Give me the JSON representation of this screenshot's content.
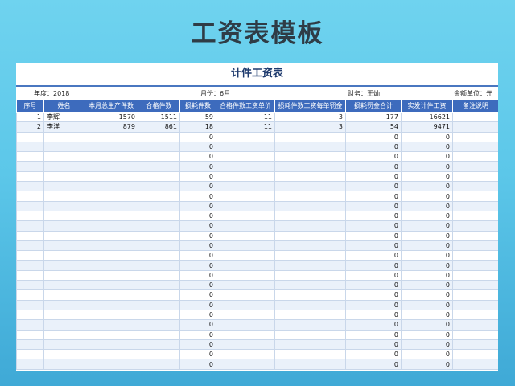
{
  "page_title": "工资表模板",
  "sheet": {
    "title": "计件工资表",
    "year_label": "年度：2018",
    "month_label": "月份：6月",
    "finance_label": "财务：王灿",
    "unit_label": "金额单位：元"
  },
  "table": {
    "headers": [
      "序号",
      "姓名",
      "本月总生产件数",
      "合格件数",
      "损耗件数",
      "合格件数工资单价",
      "损耗件数工资每单罚金",
      "损耗罚金合计",
      "实发计件工资",
      "备注说明"
    ],
    "rows": [
      [
        "1",
        "李辉",
        "1570",
        "1511",
        "59",
        "11",
        "3",
        "177",
        "16621",
        ""
      ],
      [
        "2",
        "李洋",
        "879",
        "861",
        "18",
        "11",
        "3",
        "54",
        "9471",
        ""
      ],
      [
        "",
        "",
        "",
        "",
        "0",
        "",
        "",
        "0",
        "0",
        ""
      ],
      [
        "",
        "",
        "",
        "",
        "0",
        "",
        "",
        "0",
        "0",
        ""
      ],
      [
        "",
        "",
        "",
        "",
        "0",
        "",
        "",
        "0",
        "0",
        ""
      ],
      [
        "",
        "",
        "",
        "",
        "0",
        "",
        "",
        "0",
        "0",
        ""
      ],
      [
        "",
        "",
        "",
        "",
        "0",
        "",
        "",
        "0",
        "0",
        ""
      ],
      [
        "",
        "",
        "",
        "",
        "0",
        "",
        "",
        "0",
        "0",
        ""
      ],
      [
        "",
        "",
        "",
        "",
        "0",
        "",
        "",
        "0",
        "0",
        ""
      ],
      [
        "",
        "",
        "",
        "",
        "0",
        "",
        "",
        "0",
        "0",
        ""
      ],
      [
        "",
        "",
        "",
        "",
        "0",
        "",
        "",
        "0",
        "0",
        ""
      ],
      [
        "",
        "",
        "",
        "",
        "0",
        "",
        "",
        "0",
        "0",
        ""
      ],
      [
        "",
        "",
        "",
        "",
        "0",
        "",
        "",
        "0",
        "0",
        ""
      ],
      [
        "",
        "",
        "",
        "",
        "0",
        "",
        "",
        "0",
        "0",
        ""
      ],
      [
        "",
        "",
        "",
        "",
        "0",
        "",
        "",
        "0",
        "0",
        ""
      ],
      [
        "",
        "",
        "",
        "",
        "0",
        "",
        "",
        "0",
        "0",
        ""
      ],
      [
        "",
        "",
        "",
        "",
        "0",
        "",
        "",
        "0",
        "0",
        ""
      ],
      [
        "",
        "",
        "",
        "",
        "0",
        "",
        "",
        "0",
        "0",
        ""
      ],
      [
        "",
        "",
        "",
        "",
        "0",
        "",
        "",
        "0",
        "0",
        ""
      ],
      [
        "",
        "",
        "",
        "",
        "0",
        "",
        "",
        "0",
        "0",
        ""
      ],
      [
        "",
        "",
        "",
        "",
        "0",
        "",
        "",
        "0",
        "0",
        ""
      ],
      [
        "",
        "",
        "",
        "",
        "0",
        "",
        "",
        "0",
        "0",
        ""
      ],
      [
        "",
        "",
        "",
        "",
        "0",
        "",
        "",
        "0",
        "0",
        ""
      ],
      [
        "",
        "",
        "",
        "",
        "0",
        "",
        "",
        "0",
        "0",
        ""
      ],
      [
        "",
        "",
        "",
        "",
        "0",
        "",
        "",
        "0",
        "0",
        ""
      ],
      [
        "",
        "",
        "",
        "",
        "0",
        "",
        "",
        "0",
        "0",
        ""
      ]
    ]
  }
}
